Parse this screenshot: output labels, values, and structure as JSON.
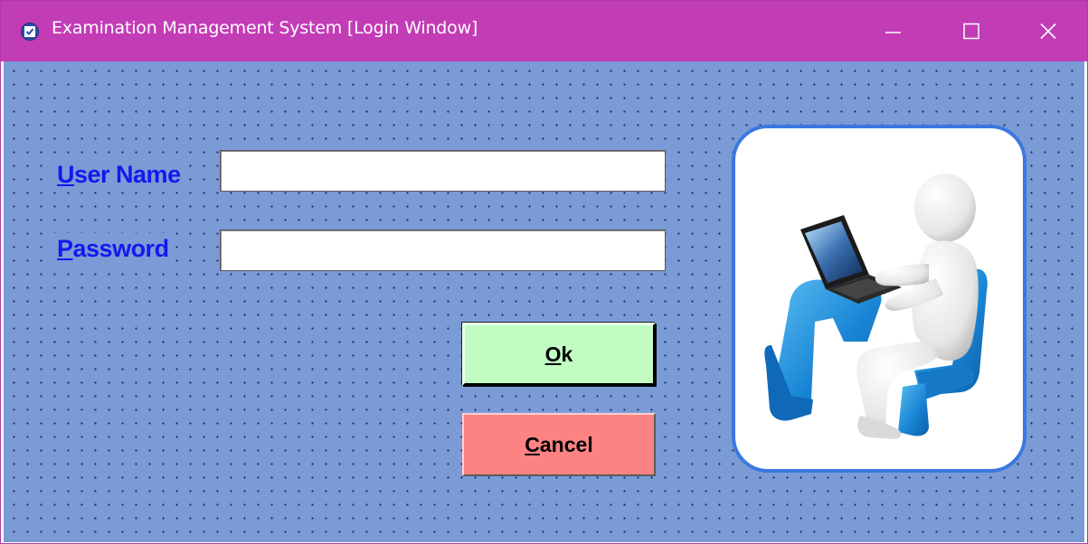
{
  "window": {
    "title": "Examination Management System [Login Window]",
    "icons": {
      "app": "checkbox-icon",
      "minimize": "minimize-icon",
      "maximize": "maximize-icon",
      "close": "close-icon"
    },
    "colors": {
      "titlebar": "#c23cb6",
      "client_background": "#7b9bd6",
      "label_text": "#1717ee",
      "ok_button": "#c2fcc2",
      "cancel_button": "#fd8383",
      "picture_border": "#3b78e0"
    }
  },
  "form": {
    "username": {
      "label_accel": "U",
      "label_rest": "ser Name",
      "value": ""
    },
    "password": {
      "label_accel": "P",
      "label_rest": "assword",
      "value": ""
    },
    "ok_button": {
      "accel": "O",
      "rest": "k"
    },
    "cancel_button": {
      "accel": "C",
      "rest": "ancel"
    }
  },
  "illustration": {
    "icon": "user-at-laptop-icon"
  }
}
